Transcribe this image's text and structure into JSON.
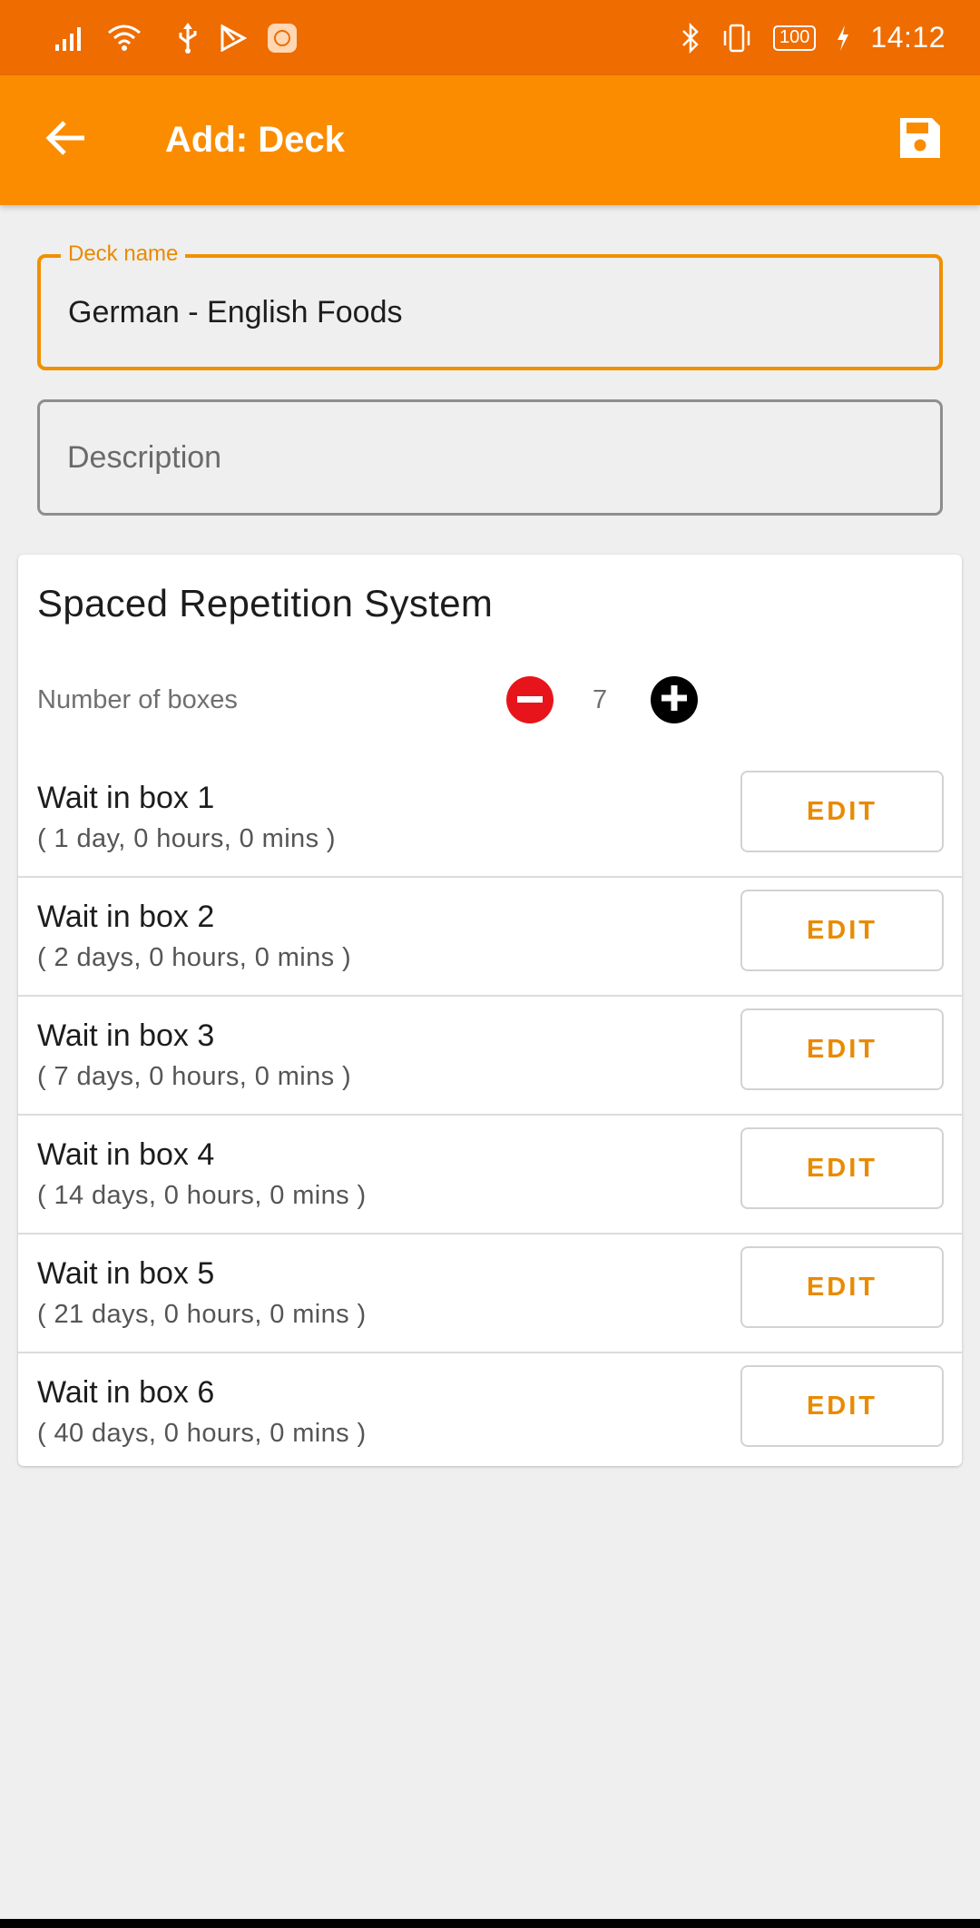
{
  "status_bar": {
    "time": "14:12",
    "battery": "100",
    "icons": [
      "signal-icon",
      "wifi-icon",
      "usb-icon",
      "play-store-icon",
      "app-notification-icon",
      "bluetooth-icon",
      "vibrate-icon",
      "battery-icon",
      "charging-icon"
    ]
  },
  "app_bar": {
    "title": "Add: Deck",
    "back_icon": "arrow-back-icon",
    "save_icon": "floppy-save-icon",
    "background": "#fb8c00"
  },
  "form": {
    "deck_name": {
      "label": "Deck name",
      "value": "German - English Foods"
    },
    "description": {
      "placeholder": "Description",
      "value": ""
    }
  },
  "srs": {
    "title": "Spaced Repetition System",
    "boxes_label": "Number of boxes",
    "boxes_count": "7",
    "minus_icon": "minus-circle-icon",
    "plus_icon": "plus-circle-icon",
    "edit_label": "EDIT",
    "rows": [
      {
        "title": "Wait in box 1",
        "duration": "( 1 day, 0 hours, 0 mins )"
      },
      {
        "title": "Wait in box 2",
        "duration": "( 2 days, 0 hours, 0 mins )"
      },
      {
        "title": "Wait in box 3",
        "duration": "( 7 days, 0 hours, 0 mins )"
      },
      {
        "title": "Wait in box 4",
        "duration": "( 14 days, 0 hours, 0 mins )"
      },
      {
        "title": "Wait in box 5",
        "duration": "( 21 days, 0 hours, 0 mins )"
      },
      {
        "title": "Wait in box 6",
        "duration": "( 40 days, 0 hours, 0 mins )"
      }
    ]
  },
  "colors": {
    "accent": "#e98a00",
    "status_bar": "#ef6c00",
    "minus": "#e8141b",
    "plus": "#000000"
  }
}
